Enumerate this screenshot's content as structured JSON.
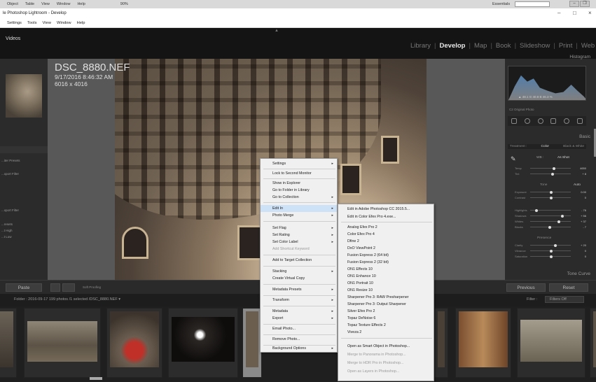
{
  "ps_bar": {
    "menus": [
      "Object",
      "Table",
      "View",
      "Window",
      "Help"
    ],
    "zoom": "90%",
    "workspace": "Essentials",
    "window_controls": [
      "–",
      "❐"
    ]
  },
  "app": {
    "title": "le Photoshop Lightroom - Develop",
    "window_controls": [
      "–",
      "□",
      "×"
    ],
    "menus": [
      "Settings",
      "Tools",
      "View",
      "Window",
      "Help"
    ]
  },
  "header": {
    "left_label": "Videos",
    "modules": [
      "Library",
      "Develop",
      "Map",
      "Book",
      "Slideshow",
      "Print",
      "Web"
    ],
    "active_module": "Develop"
  },
  "left_panel": {
    "items": [
      "...iter Presets",
      "...xport Filter",
      "...xport Filter",
      "...resets",
      "...t High",
      "...t Low"
    ]
  },
  "photo": {
    "filename": "DSC_8880.NEF",
    "datetime": "9/17/2016 8:46:32 AM",
    "dimensions": "6016 x 4016"
  },
  "right_panel": {
    "histogram_label": "Histogram",
    "histogram_readout": "▲ 48.1  G 40.8  B 46.3 %",
    "original_label": "C2 Original Photo",
    "basic_label": "Basic",
    "treatment": [
      "Treatment :",
      "Color",
      "Black & White"
    ],
    "wb_label": "WB :",
    "wb_value": "As Shot",
    "sliders": [
      {
        "label": "Temp",
        "value": "4650"
      },
      {
        "label": "Tint",
        "value": "+ 8"
      },
      {
        "label": "Exposure",
        "value": "0.00"
      },
      {
        "label": "Contrast",
        "value": "0"
      },
      {
        "label": "Highlights",
        "value": "- 76"
      },
      {
        "label": "Shadows",
        "value": "+ 56"
      },
      {
        "label": "Whites",
        "value": "+ 37"
      },
      {
        "label": "Blacks",
        "value": "- 7"
      },
      {
        "label": "Clarity",
        "value": "+ 20"
      },
      {
        "label": "Vibrance",
        "value": "0"
      },
      {
        "label": "Saturation",
        "value": "0"
      }
    ],
    "tone_label": "Tone",
    "auto_label": "Auto",
    "presence_label": "Presence",
    "tone_curve_label": "Tone Curve",
    "previous_label": "Previous",
    "reset_label": "Reset"
  },
  "bottom_toolbar": {
    "paste_label": "Paste",
    "soft_proofing": "Soft Proofing"
  },
  "filmstrip_bar": {
    "path": "Folder : 2016-09-17    199 photos /1 selected /DSC_8880.NEF ▾",
    "filter_label": "Filter :",
    "filter_value": "Filters Off"
  },
  "context_menu": {
    "items": [
      {
        "label": "Settings",
        "arrow": true
      },
      {
        "label": "Lock to Second Monitor"
      },
      {
        "label": "Show in Explorer"
      },
      {
        "label": "Go to Folder in Library"
      },
      {
        "label": "Go to Collection",
        "arrow": true
      },
      {
        "label": "Edit In",
        "arrow": true,
        "highlight": true
      },
      {
        "label": "Photo Merge",
        "arrow": true
      },
      {
        "label": "Set Flag",
        "arrow": true
      },
      {
        "label": "Set Rating",
        "arrow": true
      },
      {
        "label": "Set Color Label",
        "arrow": true
      },
      {
        "label": "Add Shortcut Keyword",
        "disabled": true
      },
      {
        "label": "Add to Target Collection"
      },
      {
        "label": "Stacking",
        "arrow": true
      },
      {
        "label": "Create Virtual Copy"
      },
      {
        "label": "Metadata Presets",
        "arrow": true
      },
      {
        "label": "Transform",
        "arrow": true
      },
      {
        "label": "Metadata",
        "arrow": true
      },
      {
        "label": "Export",
        "arrow": true
      },
      {
        "label": "Email Photo..."
      },
      {
        "label": "Remove Photo..."
      },
      {
        "label": "Background Options",
        "arrow": true
      }
    ]
  },
  "edit_in_submenu": {
    "items": [
      {
        "label": "Edit in Adobe Photoshop CC 2015.5..."
      },
      {
        "label": "Edit in Color Efex Pro 4.exe..."
      },
      {
        "label": "Analog Efex Pro 2"
      },
      {
        "label": "Color Efex Pro 4"
      },
      {
        "label": "Dfine 2"
      },
      {
        "label": "DxO ViewPoint 2"
      },
      {
        "label": "Fusion Express 2 (64 bit)"
      },
      {
        "label": "Fusion Express 2 (32 bit)"
      },
      {
        "label": "ON1 Effects 10"
      },
      {
        "label": "ON1 Enhance 10"
      },
      {
        "label": "ON1 Portrait 10"
      },
      {
        "label": "ON1 Resize 10"
      },
      {
        "label": "Sharpener Pro 3: RAW Presharpener"
      },
      {
        "label": "Sharpener Pro 3: Output Sharpener"
      },
      {
        "label": "Silver Efex Pro 2"
      },
      {
        "label": "Topaz DeNoise 6"
      },
      {
        "label": "Topaz Texture Effects 2"
      },
      {
        "label": "Viveza 2"
      },
      {
        "label": "Open as Smart Object in Photoshop..."
      },
      {
        "label": "Merge to Panorama in Photoshop...",
        "disabled": true
      },
      {
        "label": "Merge to HDR Pro in Photoshop...",
        "disabled": true
      },
      {
        "label": "Open as Layers in Photoshop...",
        "disabled": true
      }
    ]
  }
}
